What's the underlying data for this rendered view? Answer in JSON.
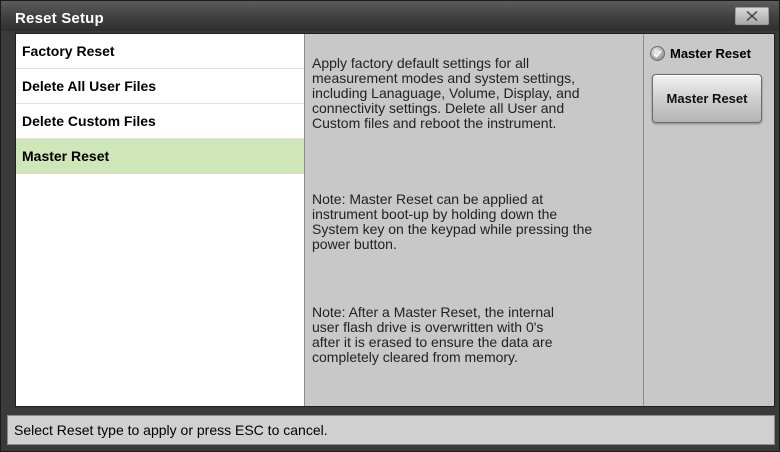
{
  "window": {
    "title": "Reset Setup",
    "close_icon": "close-x-icon"
  },
  "reset_types": [
    {
      "label": "Factory Reset",
      "selected": false
    },
    {
      "label": "Delete All User Files",
      "selected": false
    },
    {
      "label": "Delete Custom Files",
      "selected": false
    },
    {
      "label": "Master Reset",
      "selected": true
    }
  ],
  "description": {
    "para1": "Apply factory default settings for all\nmeasurement modes and system settings,\nincluding Lanaguage, Volume, Display, and\nconnectivity settings. Delete all User and\nCustom files and reboot the instrument.",
    "para2": "Note: Master Reset can be applied at\ninstrument boot-up by holding down the\nSystem key on the keypad while pressing the\npower button.",
    "para3": "Note: After a Master Reset, the internal\nuser flash drive is overwritten with 0's\nafter it is erased to ensure the data are\ncompletely cleared from memory."
  },
  "action": {
    "radio_label": "Master Reset",
    "radio_checked": true,
    "button_label": "Master Reset"
  },
  "status": {
    "text": "Select Reset type to apply or press ESC to cancel."
  },
  "colors": {
    "selected_row": "#cfe6b8",
    "titlebar": "#3f3f3f",
    "panel_bg": "#c8c8c8"
  }
}
